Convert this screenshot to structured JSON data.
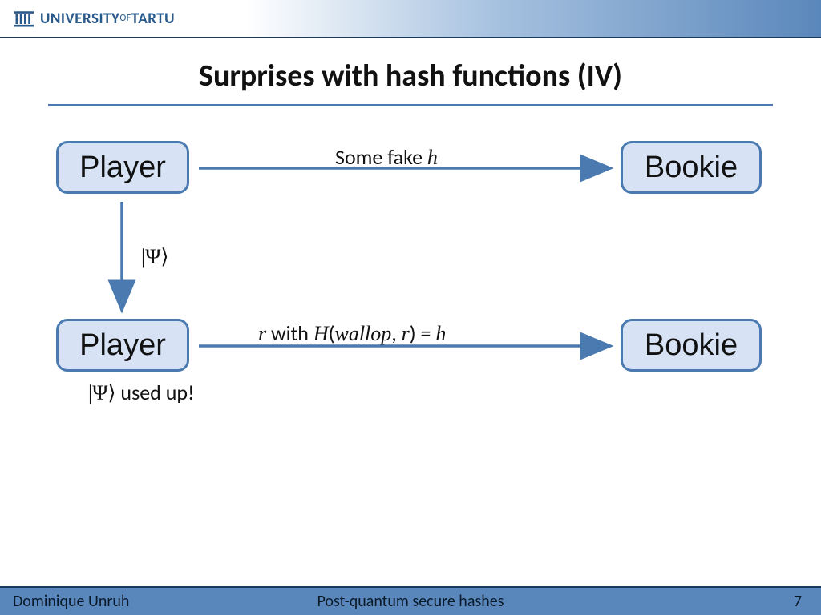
{
  "header": {
    "institution_main": "UNIVERSITY",
    "institution_of": "OF",
    "institution_sub": "TARTU"
  },
  "title": "Surprises with hash functions (IV)",
  "nodes": {
    "player1": "Player",
    "bookie1": "Bookie",
    "player2": "Player",
    "bookie2": "Bookie"
  },
  "labels": {
    "arrow1_prefix": "Some fake ",
    "arrow1_var": "h",
    "psi": "|Ψ⟩",
    "arrow2_r": "r",
    "arrow2_with": " with ",
    "arrow2_H": "H",
    "arrow2_open": "(",
    "arrow2_wallop": "wallop",
    "arrow2_comma": ", ",
    "arrow2_rvar": "r",
    "arrow2_close": ")",
    "arrow2_eq": " = ",
    "arrow2_h": "h",
    "used_up_psi": "|Ψ⟩",
    "used_up_text": " used up!"
  },
  "footer": {
    "author": "Dominique Unruh",
    "talk": "Post-quantum secure hashes",
    "page": "7"
  },
  "colors": {
    "accent": "#4a7ab0",
    "node_fill": "#d7e3f4",
    "footer_bg": "#5a87bb"
  }
}
